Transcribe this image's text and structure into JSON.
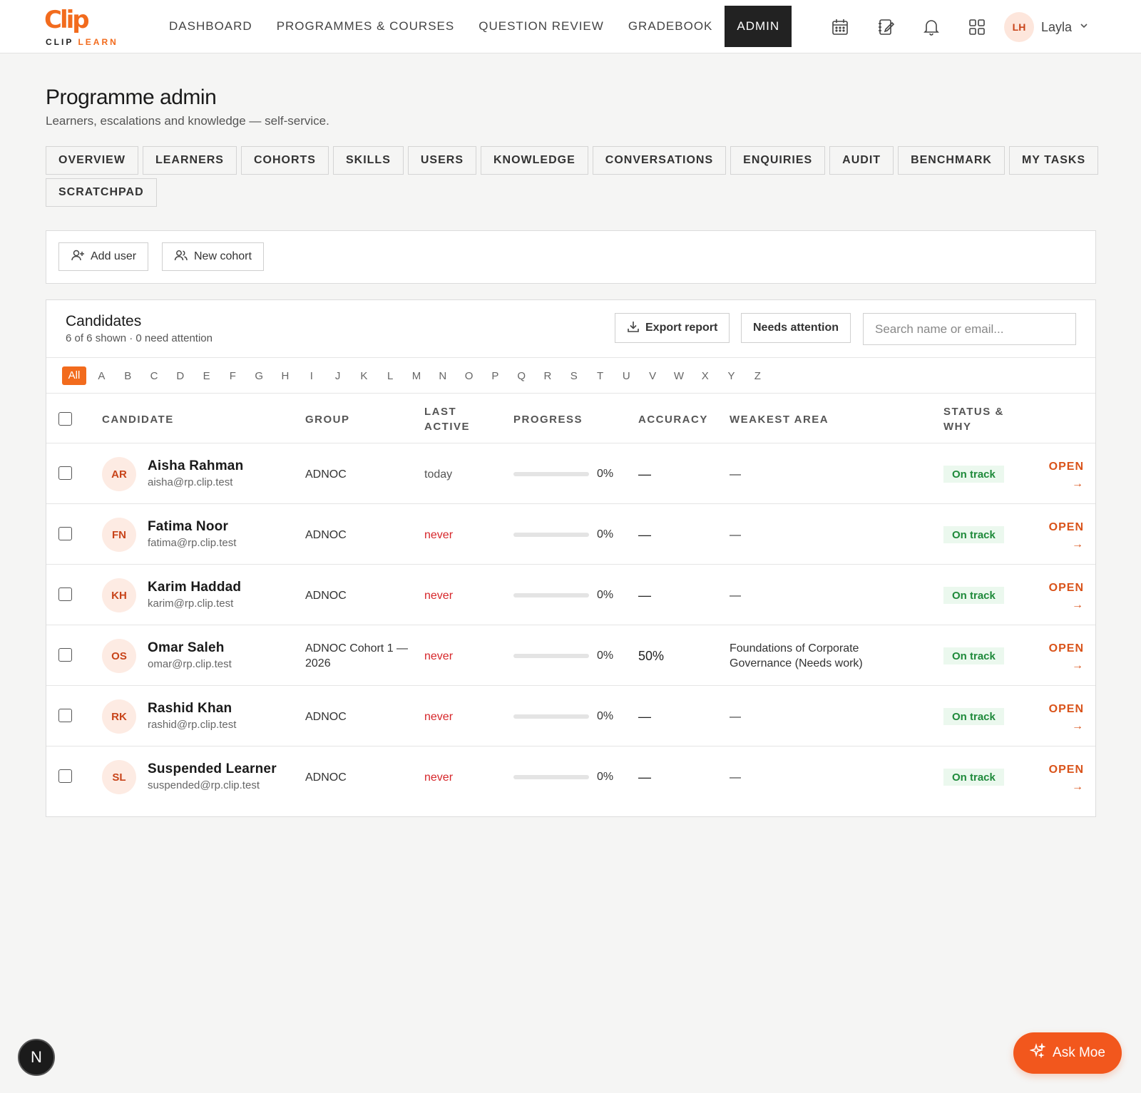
{
  "brand": {
    "logo_mark": "Clip",
    "logo_word1": "CLIP ",
    "logo_word2": "LEARN",
    "accent": "#f26b1d"
  },
  "nav": {
    "items": [
      {
        "label": "DASHBOARD"
      },
      {
        "label": "PROGRAMMES & COURSES"
      },
      {
        "label": "QUESTION REVIEW"
      },
      {
        "label": "GRADEBOOK"
      },
      {
        "label": "ADMIN",
        "active": true
      }
    ],
    "icons": [
      "calendar-icon",
      "notebook-icon",
      "bell-icon",
      "apps-grid-icon"
    ],
    "user": {
      "initials": "LH",
      "name": "Layla"
    }
  },
  "header": {
    "title": "Programme admin",
    "subtitle": "Learners, escalations and knowledge — self-service."
  },
  "tabs": [
    {
      "label": "OVERVIEW"
    },
    {
      "label": "LEARNERS"
    },
    {
      "label": "COHORTS"
    },
    {
      "label": "SKILLS"
    },
    {
      "label": "USERS"
    },
    {
      "label": "KNOWLEDGE"
    },
    {
      "label": "CONVERSATIONS"
    },
    {
      "label": "ENQUIRIES"
    },
    {
      "label": "AUDIT"
    },
    {
      "label": "BENCHMARK"
    },
    {
      "label": "MY TASKS"
    },
    {
      "label": "SCRATCHPAD"
    }
  ],
  "actions": {
    "add_user": "Add user",
    "new_cohort": "New cohort"
  },
  "candidates": {
    "title": "Candidates",
    "summary": "6 of 6 shown · 0 need attention",
    "export_label": "Export report",
    "needs_attention_label": "Needs attention",
    "search_placeholder": "Search name or email...",
    "alphabet": [
      "All",
      "A",
      "B",
      "C",
      "D",
      "E",
      "F",
      "G",
      "H",
      "I",
      "J",
      "K",
      "L",
      "M",
      "N",
      "O",
      "P",
      "Q",
      "R",
      "S",
      "T",
      "U",
      "V",
      "W",
      "X",
      "Y",
      "Z"
    ],
    "alphabet_active": "All",
    "columns": {
      "candidate": "CANDIDATE",
      "group": "GROUP",
      "last_active_1": "LAST",
      "last_active_2": "ACTIVE",
      "progress": "PROGRESS",
      "accuracy": "ACCURACY",
      "weakest": "WEAKEST AREA",
      "status_1": "STATUS &",
      "status_2": "WHY"
    },
    "rows": [
      {
        "initials": "AR",
        "name": "Aisha Rahman",
        "email": "aisha@rp.clip.test",
        "group": "ADNOC",
        "last_active": "today",
        "never": false,
        "progress": 0,
        "progress_label": "0%",
        "accuracy": "—",
        "weakest": "—",
        "status": "On track",
        "open": "OPEN"
      },
      {
        "initials": "FN",
        "name": "Fatima Noor",
        "email": "fatima@rp.clip.test",
        "group": "ADNOC",
        "last_active": "never",
        "never": true,
        "progress": 0,
        "progress_label": "0%",
        "accuracy": "—",
        "weakest": "—",
        "status": "On track",
        "open": "OPEN"
      },
      {
        "initials": "KH",
        "name": "Karim Haddad",
        "email": "karim@rp.clip.test",
        "group": "ADNOC",
        "last_active": "never",
        "never": true,
        "progress": 0,
        "progress_label": "0%",
        "accuracy": "—",
        "weakest": "—",
        "status": "On track",
        "open": "OPEN"
      },
      {
        "initials": "OS",
        "name": "Omar Saleh",
        "email": "omar@rp.clip.test",
        "group": "ADNOC Cohort 1 — 2026",
        "last_active": "never",
        "never": true,
        "progress": 0,
        "progress_label": "0%",
        "accuracy": "50%",
        "weakest": "Foundations of Corporate Governance (Needs work)",
        "status": "On track",
        "open": "OPEN"
      },
      {
        "initials": "RK",
        "name": "Rashid Khan",
        "email": "rashid@rp.clip.test",
        "group": "ADNOC",
        "last_active": "never",
        "never": true,
        "progress": 0,
        "progress_label": "0%",
        "accuracy": "—",
        "weakest": "—",
        "status": "On track",
        "open": "OPEN"
      },
      {
        "initials": "SL",
        "name": "Suspended Learner",
        "email": "suspended@rp.clip.test",
        "group": "ADNOC",
        "last_active": "never",
        "never": true,
        "progress": 0,
        "progress_label": "0%",
        "accuracy": "—",
        "weakest": "—",
        "status": "On track",
        "open": "OPEN"
      }
    ]
  },
  "floating": {
    "n_badge": "N",
    "ask_label": "Ask Moe"
  }
}
